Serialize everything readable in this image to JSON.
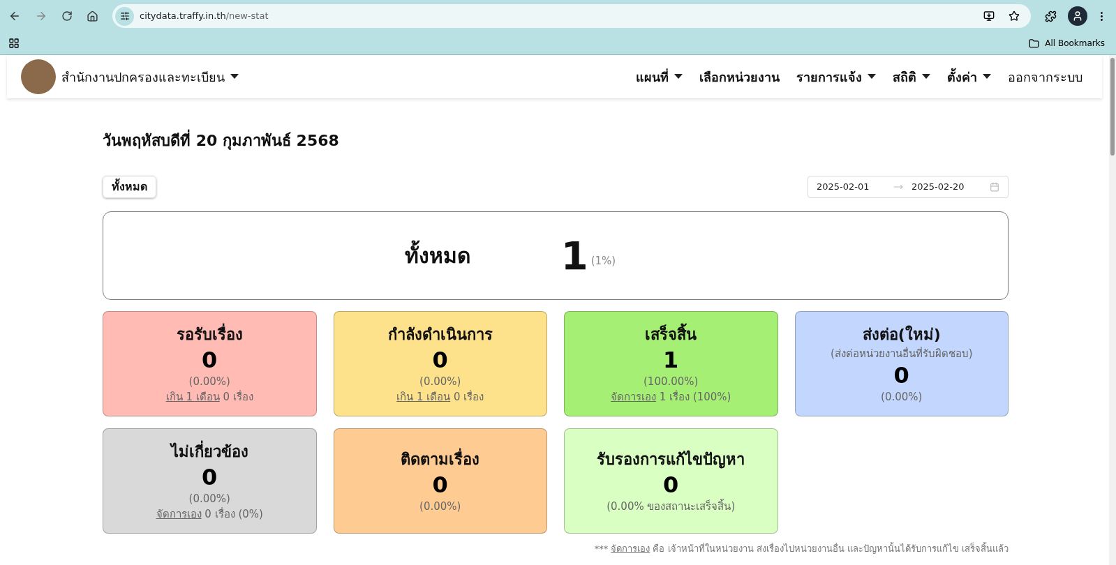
{
  "browser": {
    "url_host": "citydata.traffy.in.th",
    "url_path": "/new-stat",
    "bookmarks_label": "All Bookmarks"
  },
  "navbar": {
    "org": "สำนักงานปกครองและทะเบียน",
    "items": [
      {
        "label": "แผนที่",
        "dropdown": true
      },
      {
        "label": "เลือกหน่วยงาน",
        "dropdown": false
      },
      {
        "label": "รายการแจ้ง",
        "dropdown": true
      },
      {
        "label": "สถิติ",
        "dropdown": true
      },
      {
        "label": "ตั้งค่า",
        "dropdown": true
      },
      {
        "label": "ออกจากระบบ",
        "dropdown": false
      }
    ]
  },
  "date_heading": "วันพฤหัสบดีที่ 20 กุมภาพันธ์ 2568",
  "filter_button": "ทั้งหมด",
  "date_range": {
    "start": "2025-02-01",
    "end": "2025-02-20"
  },
  "total": {
    "label": "ทั้งหมด",
    "value": "1",
    "percent": "(1%)"
  },
  "cards": [
    {
      "title": "รอรับเรื่อง",
      "value": "0",
      "percent": "(0.00%)",
      "note_link": "เกิน 1 เดือน",
      "note_rest": " 0 เรื่อง",
      "color": "#ffbbb4"
    },
    {
      "title": "กำลังดำเนินการ",
      "value": "0",
      "percent": "(0.00%)",
      "note_link": "เกิน 1 เดือน",
      "note_rest": " 0 เรื่อง",
      "color": "#fde18b"
    },
    {
      "title": "เสร็จสิ้น",
      "value": "1",
      "percent": "(100.00%)",
      "note_link": "จัดการเอง",
      "note_rest": " 1 เรื่อง (100%)",
      "color": "#a6ef75"
    },
    {
      "title": "ส่งต่อ(ใหม่)",
      "subtitle": "(ส่งต่อหน่วยงานอื่นที่รับผิดชอบ)",
      "value": "0",
      "percent": "(0.00%)",
      "color": "#c3d6fd"
    },
    {
      "title": "ไม่เกี่ยวข้อง",
      "value": "0",
      "percent": "(0.00%)",
      "note_link": "จัดการเอง",
      "note_rest": " 0 เรื่อง (0%)",
      "color": "#d9d9d9"
    },
    {
      "title": "ติดตามเรื่อง",
      "value": "0",
      "percent": "(0.00%)",
      "color": "#fecb93"
    },
    {
      "title": "รับรองการแก้ไขปัญหา",
      "value": "0",
      "percent": "(0.00% ของสถานะเสร็จสิ้น)",
      "color": "#daffc3"
    }
  ],
  "footer_note": {
    "prefix": "*** ",
    "link": "จัดการเอง",
    "rest": " คือ เจ้าหน้าที่ในหน่วยงาน ส่งเรื่องไปหน่วยงานอื่น และปัญหานั้นได้รับการแก้ไข เสร็จสิ้นแล้ว"
  }
}
